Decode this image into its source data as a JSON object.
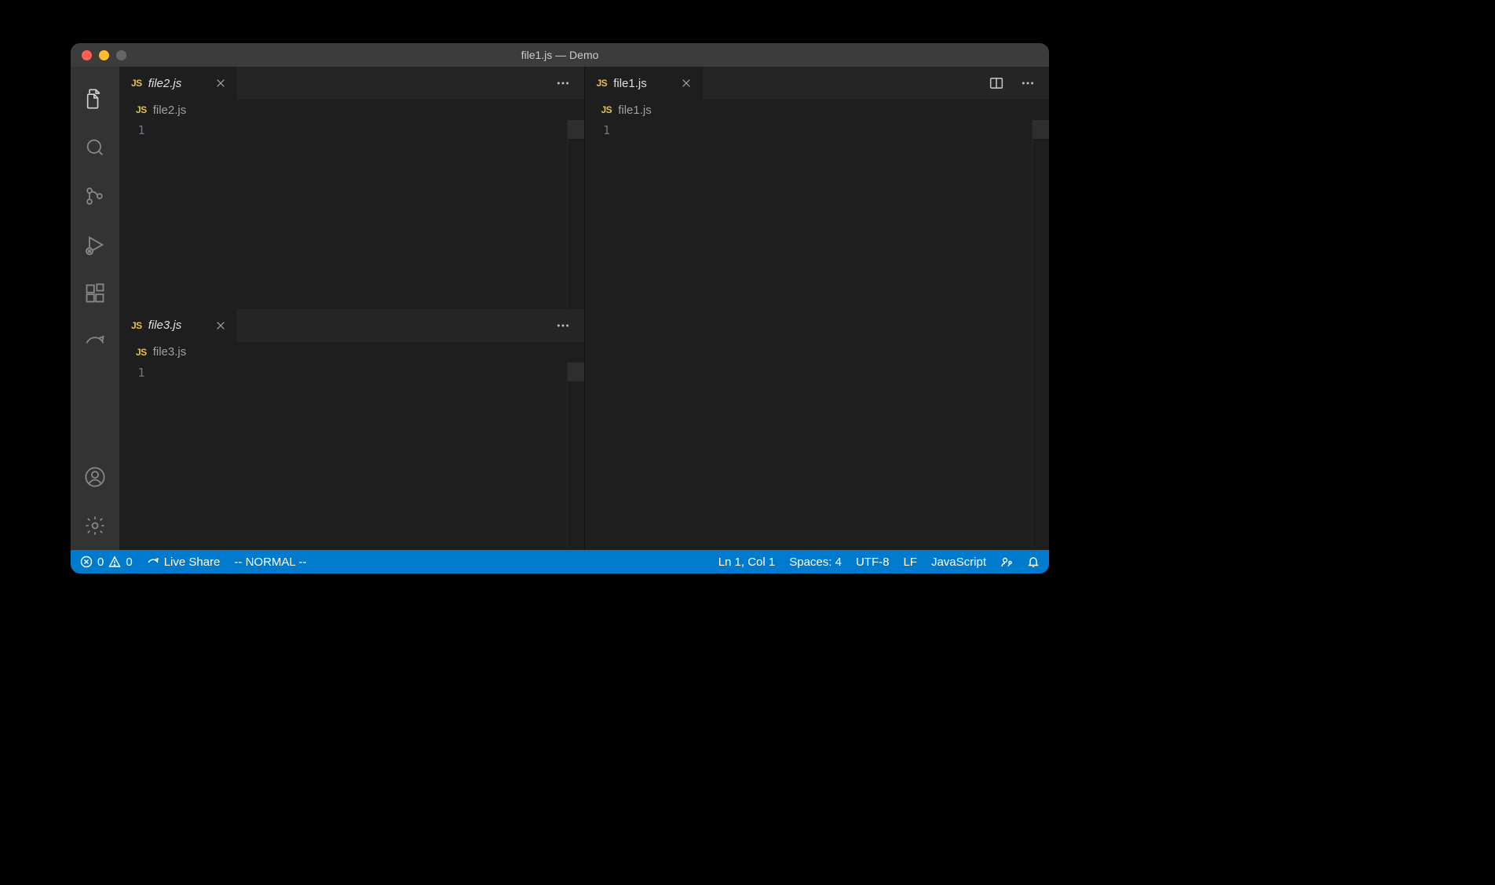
{
  "window": {
    "title": "file1.js — Demo"
  },
  "activitybar": {
    "items": [
      {
        "name": "explorer-icon"
      },
      {
        "name": "search-icon"
      },
      {
        "name": "source-control-icon"
      },
      {
        "name": "run-debug-icon"
      },
      {
        "name": "extensions-icon"
      },
      {
        "name": "live-share-icon"
      }
    ],
    "bottom": [
      {
        "name": "account-icon"
      },
      {
        "name": "gear-icon"
      }
    ]
  },
  "editor": {
    "groups": [
      {
        "position": "left-top",
        "tabs": [
          {
            "js_prefix": "JS",
            "label": "file2.js",
            "italic": true
          }
        ],
        "breadcrumb": {
          "js_prefix": "JS",
          "text": "file2.js"
        },
        "line_number": "1",
        "actions": {
          "split": false,
          "more": true
        }
      },
      {
        "position": "left-bottom",
        "tabs": [
          {
            "js_prefix": "JS",
            "label": "file3.js",
            "italic": true
          }
        ],
        "breadcrumb": {
          "js_prefix": "JS",
          "text": "file3.js"
        },
        "line_number": "1",
        "actions": {
          "split": false,
          "more": true
        }
      },
      {
        "position": "right",
        "tabs": [
          {
            "js_prefix": "JS",
            "label": "file1.js",
            "italic": false
          }
        ],
        "breadcrumb": {
          "js_prefix": "JS",
          "text": "file1.js"
        },
        "line_number": "1",
        "actions": {
          "split": true,
          "more": true
        }
      }
    ]
  },
  "statusbar": {
    "errors": "0",
    "warnings": "0",
    "liveshare": "Live Share",
    "vim_mode": "-- NORMAL --",
    "ln_col": "Ln 1, Col 1",
    "spaces": "Spaces: 4",
    "encoding": "UTF-8",
    "eol": "LF",
    "language": "JavaScript"
  }
}
